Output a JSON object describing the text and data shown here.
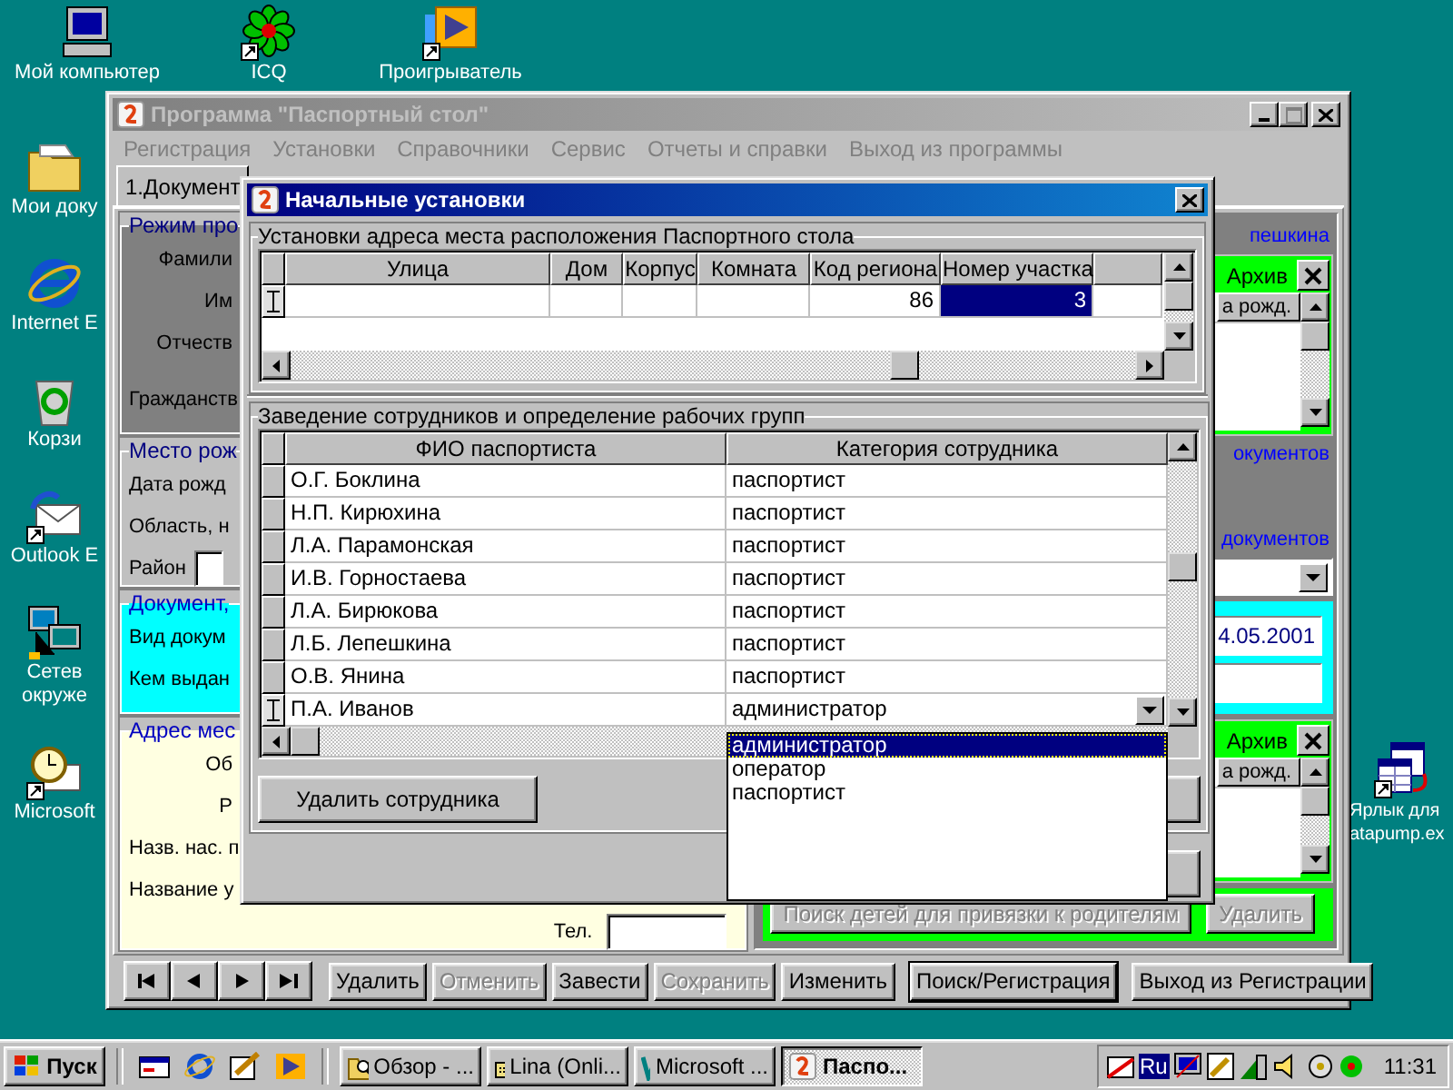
{
  "desktop": {
    "top_icons": [
      {
        "kind": "computer",
        "lines": [
          "Мой компьютер"
        ]
      },
      {
        "kind": "flower",
        "lines": [
          "ICQ"
        ]
      },
      {
        "kind": "player",
        "lines": [
          "Проигрыватель"
        ]
      }
    ],
    "left_icons": [
      {
        "kind": "folder",
        "lines": [
          "Мои доку"
        ]
      },
      {
        "kind": "browser",
        "lines": [
          "Internet E"
        ]
      },
      {
        "kind": "bin",
        "lines": [
          "Корзи"
        ]
      },
      {
        "kind": "mail",
        "lines": [
          "Outlook E"
        ]
      },
      {
        "kind": "network",
        "lines": [
          "Сетев",
          "окруже"
        ]
      },
      {
        "kind": "clock",
        "lines": [
          "Microsoft "
        ]
      }
    ],
    "right_icons": [
      {
        "kind": "tables",
        "lines": [
          "Ярлык для",
          "atapump.ex"
        ]
      }
    ]
  },
  "main_window": {
    "title": "Программа \"Паспортный стол\"",
    "active": false,
    "menu": [
      "Регистрация",
      "Установки",
      "Справочники",
      "Сервис",
      "Отчеты и справки",
      "Выход из программы"
    ],
    "tabs": [
      {
        "label": "1.Документ",
        "selected": true
      }
    ],
    "left_groups": [
      {
        "kind": "dark",
        "title": "Режим про",
        "labels": [
          "Фамили",
          "Им",
          "Отчеств",
          "Гражданств"
        ]
      },
      {
        "kind": "gray",
        "title": "Место рож",
        "labels": [
          "Дата рожд",
          "Область, н",
          "Район"
        ]
      },
      {
        "kind": "cyan",
        "title": "Документ,",
        "labels": [
          "Вид докум",
          "Кем выдан"
        ]
      },
      {
        "kind": "yellow",
        "title": "Адрес мес",
        "labels": [
          "Об",
          "Р",
          "Назв. нас. п",
          "Название у"
        ],
        "phone_label": "Тел."
      }
    ],
    "right": {
      "caption": "пешкина",
      "top_list": {
        "tab": "Архив",
        "column": "а рожд."
      },
      "links": [
        "окументов",
        "документов"
      ],
      "date": "4.05.2001",
      "bottom_list": {
        "tab": "Архив",
        "column": "а рожд."
      },
      "buttons": [
        {
          "label": "Поиск детей для привязки к родителям",
          "disabled": true
        },
        {
          "label": "Удалить",
          "disabled": true
        }
      ]
    },
    "nav": [
      {
        "kind": "first"
      },
      {
        "kind": "prev"
      },
      {
        "kind": "next"
      },
      {
        "kind": "last"
      }
    ],
    "toolbar": [
      {
        "label": "Удалить",
        "disabled": false,
        "default": false
      },
      {
        "label": "Отменить",
        "disabled": true,
        "default": false
      },
      {
        "label": "Завести",
        "disabled": false,
        "default": false
      },
      {
        "label": "Сохранить",
        "disabled": true,
        "default": false
      },
      {
        "label": "Изменить",
        "disabled": false,
        "default": false
      },
      {
        "label": "Поиск/Регистрация",
        "disabled": false,
        "default": true
      },
      {
        "label": "Выход из Регистрации",
        "disabled": false,
        "default": false
      }
    ]
  },
  "dialog": {
    "title": "Начальные установки",
    "active": true,
    "address_group": {
      "title": "Установки адреса места расположения Паспортного стола",
      "columns": [
        "Улица",
        "Дом",
        "Корпус",
        "Комната",
        "Код региона",
        "Номер участка"
      ],
      "row": {
        "current": true,
        "region_code": "86",
        "district_number": "3",
        "district_selected": true
      }
    },
    "staff_group": {
      "title": "Заведение сотрудников и определение рабочих групп",
      "columns": [
        "ФИО паспортиста",
        "Категория сотрудника"
      ],
      "rows": [
        {
          "name": "О.Г. Боклина",
          "category": "паспортист",
          "current": false
        },
        {
          "name": "Н.П. Кирюхина",
          "category": "паспортист",
          "current": false
        },
        {
          "name": "Л.А. Парамонская",
          "category": "паспортист",
          "current": false
        },
        {
          "name": "И.В. Горностаева",
          "category": "паспортист",
          "current": false
        },
        {
          "name": "Л.А. Бирюкова",
          "category": "паспортист",
          "current": false
        },
        {
          "name": "Л.Б. Лепешкина",
          "category": "паспортист",
          "current": false
        },
        {
          "name": "О.В. Янина",
          "category": "паспортист",
          "current": false
        },
        {
          "name": "П.А. Иванов",
          "category": "администратор",
          "current": true
        }
      ],
      "dropdown": [
        {
          "label": "администратор",
          "selected": true
        },
        {
          "label": "оператор",
          "selected": false
        },
        {
          "label": "паспортист",
          "selected": false
        }
      ],
      "delete_button": "Удалить сотрудника"
    }
  },
  "taskbar": {
    "start": "Пуск",
    "quick_launch": [
      {
        "kind": "desktop"
      },
      {
        "kind": "browser"
      },
      {
        "kind": "pen"
      },
      {
        "kind": "player"
      }
    ],
    "tasks": [
      {
        "kind": "search",
        "label": "Обзор - ...",
        "selected": false
      },
      {
        "kind": "chat",
        "label": "Lina (Onli...",
        "selected": false
      },
      {
        "kind": "word",
        "label": "Microsoft ...",
        "selected": false
      },
      {
        "kind": "app",
        "label": "Паспо...",
        "selected": true
      }
    ],
    "language": "Ru",
    "time": "11:31"
  }
}
